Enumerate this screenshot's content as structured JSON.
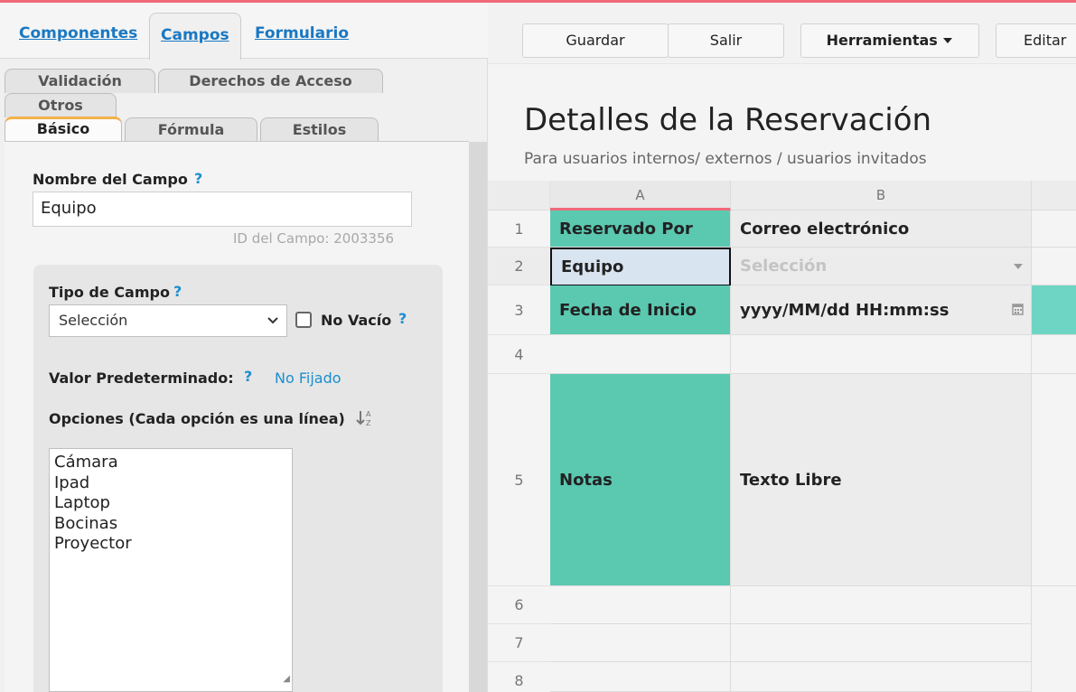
{
  "left": {
    "main_tabs": [
      "Componentes",
      "Campos",
      "Formulario"
    ],
    "sub_tabs_row1": [
      "Validación",
      "Derechos de Acceso"
    ],
    "sub_tabs_row2": [
      "Otros"
    ],
    "sub_tabs_row3": [
      "Básico",
      "Fórmula",
      "Estilos"
    ],
    "field_name_label": "Nombre del Campo",
    "help_mark": "?",
    "field_name_value": "Equipo",
    "field_id": "ID del Campo: 2003356",
    "field_type_label": "Tipo de Campo",
    "field_type_value": "Selección",
    "not_empty_label": "No Vacío",
    "default_label": "Valor Predeterminado:",
    "default_value": "No Fijado",
    "options_label": "Opciones (Cada opción es una línea)",
    "options": [
      "Cámara",
      "Ipad",
      "Laptop",
      "Bocinas",
      "Proyector"
    ]
  },
  "toolbar": {
    "save": "Guardar",
    "exit": "Salir",
    "tools": "Herramientas",
    "edit": "Editar"
  },
  "sheet": {
    "title": "Detalles de la Reservación",
    "subtitle": "Para usuarios internos/ externos / usuarios invitados",
    "columns": [
      "A",
      "B"
    ],
    "rows": [
      "1",
      "2",
      "3",
      "4",
      "5",
      "6",
      "7",
      "8"
    ],
    "cells": {
      "a1": "Reservado Por",
      "b1": "Correo electrónico",
      "a2": "Equipo",
      "b2": "Selección",
      "a3": "Fecha de Inicio",
      "b3": "yyyy/MM/dd HH:mm:ss",
      "a5": "Notas",
      "b5": "Texto Libre"
    }
  },
  "colors": {
    "teal": "#5bc8b0",
    "link_blue": "#1a78c2",
    "accent_red": "#f06a7a",
    "tab_orange": "#f2b24a"
  }
}
